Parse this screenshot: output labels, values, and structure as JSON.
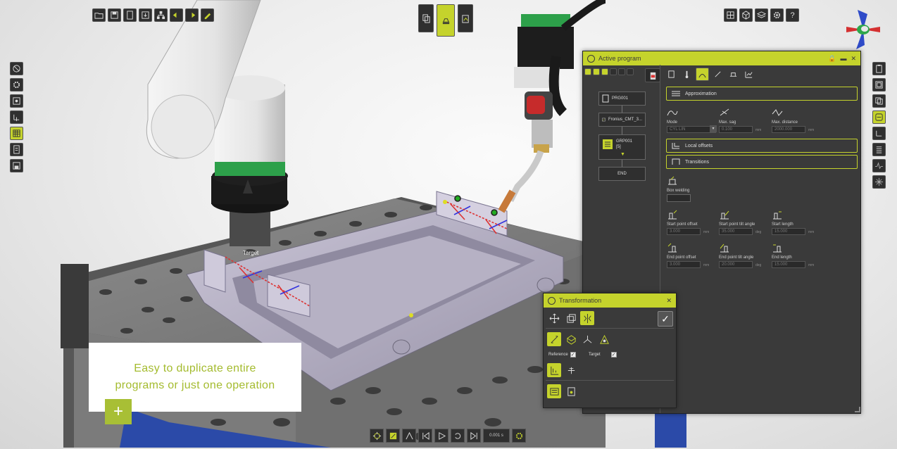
{
  "viewport": {
    "target_label": "Target",
    "accent_color": "#c5d32c",
    "panel_color": "#3a3a3a"
  },
  "top_left_toolbar": {
    "icons": [
      "open-folder-icon",
      "save-icon",
      "document-icon",
      "export-icon",
      "network-icon",
      "arrow-left-icon",
      "arrow-right-icon",
      "pencil-icon"
    ]
  },
  "top_center_toolbar": {
    "icons": [
      "copy-program-icon",
      "weld-table-icon",
      "paste-program-icon"
    ]
  },
  "top_right_toolbar": {
    "icons": [
      "grid-layout-icon",
      "cube-icon",
      "layers-icon",
      "settings-icon"
    ],
    "help_label": "?"
  },
  "active_program": {
    "title": "Active program",
    "tree": [
      {
        "label": "PRG001",
        "icon": "document-icon"
      },
      {
        "label": "Fronius_CMT_3...",
        "icon": "weld-source-icon"
      },
      {
        "label": "GRP001",
        "sub": "[5]",
        "icon": "group-icon"
      },
      {
        "label": "END",
        "icon": ""
      }
    ],
    "sections": {
      "approximation": "Approximation",
      "local_offsets": "Local offsets",
      "transitions": "Transitions"
    },
    "mode": {
      "label": "Mode",
      "value": "CYL LIN"
    },
    "max_sag": {
      "label": "Max. sag",
      "value": "0.100",
      "unit": "mm"
    },
    "max_distance": {
      "label": "Max. distance",
      "value": "2000.000",
      "unit": "mm"
    },
    "box_welding": {
      "label": "Box welding"
    },
    "start_point_offset": {
      "label": "Start point offset",
      "value": "3.000",
      "unit": "mm"
    },
    "start_point_tilt": {
      "label": "Start point tilt angle",
      "value": "35.000",
      "unit": "deg"
    },
    "start_length": {
      "label": "Start length",
      "value": "15.000",
      "unit": "mm"
    },
    "end_point_offset": {
      "label": "End point offset",
      "value": "3.000",
      "unit": "mm"
    },
    "end_point_tilt": {
      "label": "End point tilt angle",
      "value": "20.000",
      "unit": "deg"
    },
    "end_length": {
      "label": "End length",
      "value": "15.000",
      "unit": "mm"
    }
  },
  "transformation": {
    "title": "Transformation",
    "reference_label": "Reference",
    "target_label": "Target",
    "check_mark": "✓"
  },
  "callout": {
    "line1": "Easy to duplicate entire",
    "line2": "programs or just one operation",
    "plus": "+"
  },
  "bottom_toolbar": {
    "speed": "0.001",
    "speed_unit": "s"
  }
}
